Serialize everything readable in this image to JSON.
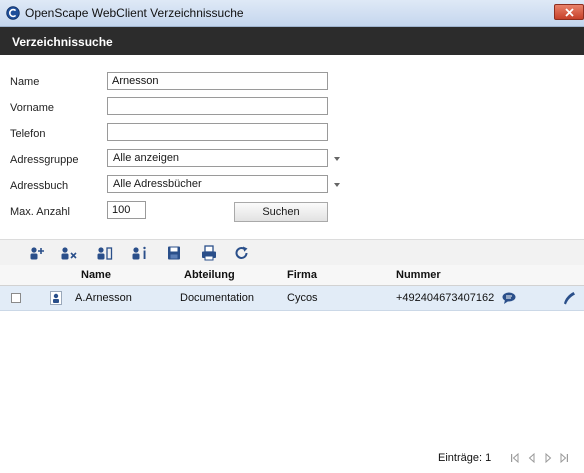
{
  "window": {
    "title": "OpenScape WebClient Verzeichnissuche"
  },
  "header": {
    "title": "Verzeichnissuche"
  },
  "form": {
    "name": {
      "label": "Name",
      "value": "Arnesson"
    },
    "vorname": {
      "label": "Vorname",
      "value": ""
    },
    "telefon": {
      "label": "Telefon",
      "value": ""
    },
    "adressgruppe": {
      "label": "Adressgruppe",
      "value": "Alle anzeigen"
    },
    "adressbuch": {
      "label": "Adressbuch",
      "value": "Alle Adressbücher"
    },
    "max": {
      "label": "Max. Anzahl",
      "value": "100"
    },
    "search_button": "Suchen"
  },
  "toolbar": [
    "add-contact-icon",
    "remove-contact-icon",
    "contact-edit-icon",
    "contact-info-icon",
    "save-icon",
    "print-icon",
    "refresh-icon"
  ],
  "table": {
    "columns": [
      "Name",
      "Abteilung",
      "Firma",
      "Nummer"
    ],
    "rows": [
      {
        "name": "A.Arnesson",
        "abteilung": "Documentation",
        "firma": "Cycos",
        "nummer": "+492404673407162"
      }
    ]
  },
  "status": {
    "count_label": "Einträge: 1"
  },
  "colors": {
    "header_bg": "#2c2c2c",
    "row_bg": "#e2ecf7",
    "accent": "#2a4f8a"
  }
}
